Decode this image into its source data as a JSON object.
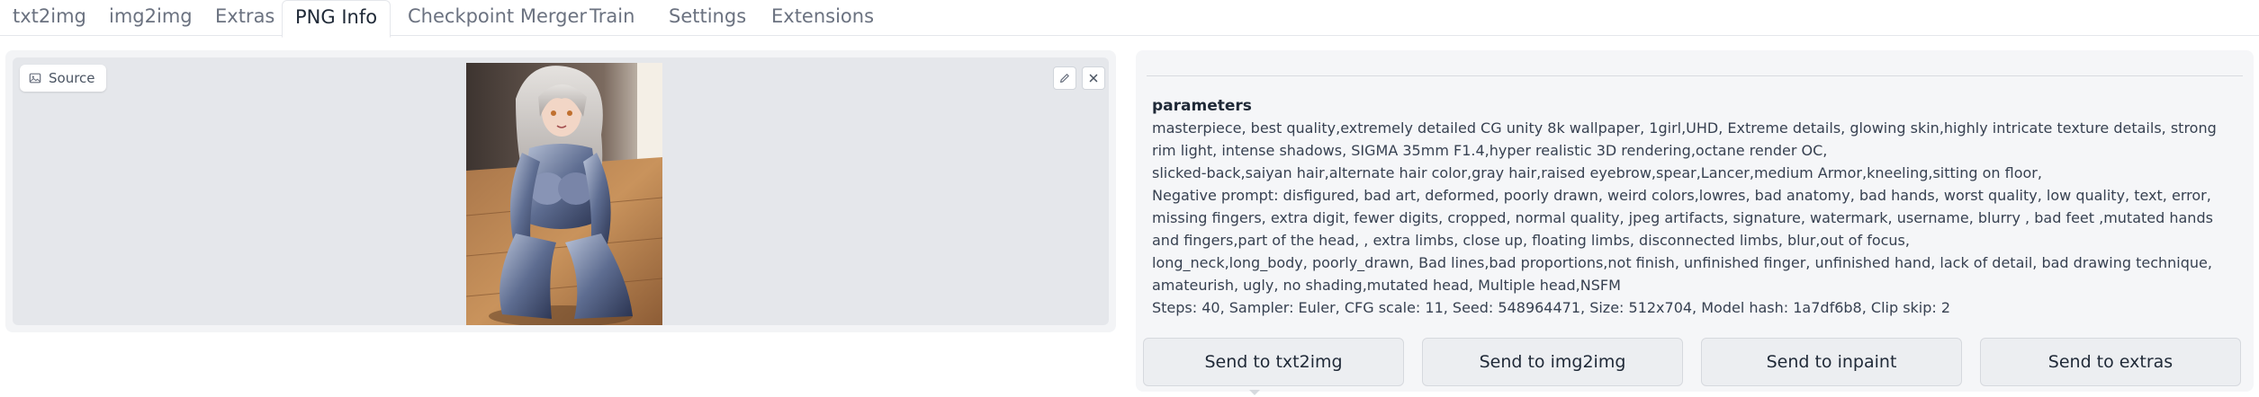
{
  "tabs": [
    {
      "label": "txt2img",
      "active": false
    },
    {
      "label": "img2img",
      "active": false
    },
    {
      "label": "Extras",
      "active": false
    },
    {
      "label": "PNG Info",
      "active": true
    },
    {
      "label": "Checkpoint Merger",
      "active": false
    },
    {
      "label": "Train",
      "active": false
    },
    {
      "label": "Settings",
      "active": false
    },
    {
      "label": "Extensions",
      "active": false
    }
  ],
  "image_panel": {
    "source_label": "Source",
    "icons": [
      "image-icon",
      "edit-icon",
      "close-icon"
    ]
  },
  "info": {
    "title": "parameters",
    "lines": [
      "masterpiece, best quality,extremely detailed CG unity 8k wallpaper, 1girl,UHD, Extreme details, glowing skin,highly intricate texture details, strong rim light, intense shadows, SIGMA 35mm F1.4,hyper realistic 3D rendering,octane render OC,",
      "slicked-back,saiyan hair,alternate hair color,gray hair,raised eyebrow,spear,Lancer,medium Armor,kneeling,sitting on floor,",
      "Negative prompt: disfigured, bad art, deformed, poorly drawn, weird colors,lowres, bad anatomy, bad hands, worst quality, low quality, text, error, missing fingers, extra digit, fewer digits, cropped, normal quality, jpeg artifacts, signature, watermark, username, blurry , bad feet ,mutated hands and fingers,part of the head, , extra limbs, close up, floating limbs, disconnected limbs, blur,out of focus,",
      "long_neck,long_body, poorly_drawn, Bad lines,bad proportions,not finish, unfinished finger, unfinished hand, lack of detail, bad drawing technique, amateurish, ugly, no shading,mutated head, Multiple head,NSFM",
      "Steps: 40, Sampler: Euler, CFG scale: 11, Seed: 548964471, Size: 512x704, Model hash: 1a7df6b8, Clip skip: 2"
    ]
  },
  "buttons": {
    "send_txt2img": "Send to txt2img",
    "send_img2img": "Send to img2img",
    "send_inpaint": "Send to inpaint",
    "send_extras": "Send to extras"
  },
  "colors": {
    "panel_bg": "#f3f4f6",
    "image_bg": "#e5e7eb",
    "button_bg": "#eceef1",
    "tab_inactive": "#6b7280"
  }
}
